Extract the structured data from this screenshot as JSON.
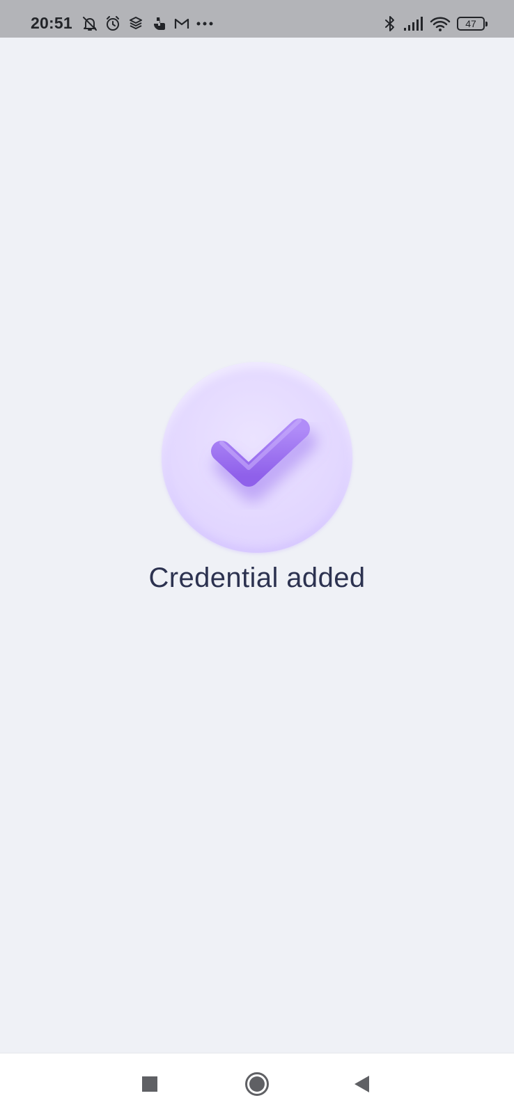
{
  "status_bar": {
    "time": "20:51",
    "battery_level": "47",
    "left_icons": [
      "bell-off-icon",
      "alarm-icon",
      "app-icon",
      "phone-app-icon",
      "gmail-icon",
      "more-notifications-icon"
    ],
    "right_icons": [
      "bluetooth-icon",
      "signal-icon",
      "wifi-icon",
      "battery-icon"
    ]
  },
  "main": {
    "success_icon": "checkmark-icon",
    "message": "Credential added",
    "accent_color": "#9a6cf0",
    "badge_color": "#e3d8ff"
  },
  "nav_bar": {
    "buttons": [
      "recent-apps-icon",
      "home-icon",
      "back-icon"
    ]
  }
}
